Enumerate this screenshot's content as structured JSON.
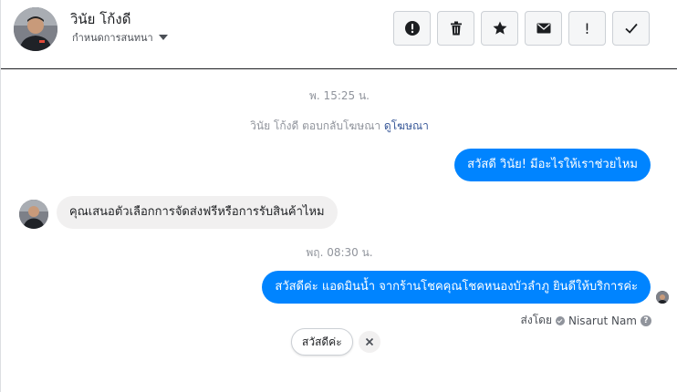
{
  "header": {
    "contact_name": "วินัย โก้งดี",
    "assign_label": "กำหนดการสนทนา",
    "toolbar": [
      {
        "icon": "alert-circle-icon",
        "name": "spam-button"
      },
      {
        "icon": "trash-icon",
        "name": "delete-button"
      },
      {
        "icon": "star-icon",
        "name": "star-button"
      },
      {
        "icon": "envelope-icon",
        "name": "mark-unread-button"
      },
      {
        "icon": "exclamation-icon",
        "name": "follow-up-button",
        "glyph": "!"
      },
      {
        "icon": "checkmark-icon",
        "name": "mark-done-button"
      }
    ]
  },
  "thread": {
    "timestamp_1": "พ. 15:25 น.",
    "notice_text": "วินัย โก้งดี ตอบกลับโฆษณา",
    "notice_link": "ดูโฆษณา",
    "msg_out_1": "สวัสดี วินัย! มีอะไรให้เราช่วยไหม",
    "msg_in_1": "คุณเสนอตัวเลือกการจัดส่งฟรีหรือการรับสินค้าไหม",
    "timestamp_2": "พฤ. 08:30 น.",
    "msg_out_2": "สวัสดีค่ะ แอดมินน้ำ จากร้านโชคคุณโชคหนองบัวลำภู ยินดีให้บริการค่ะ",
    "sent_by_label": "ส่งโดย",
    "sent_by_name": "Nisarut Nam",
    "quick_reply": "สวัสดีค่ะ"
  },
  "colors": {
    "outgoing_bubble": "#0084ff",
    "incoming_bubble": "#f1f0f0",
    "link": "#385898",
    "muted_text": "#90949c"
  }
}
